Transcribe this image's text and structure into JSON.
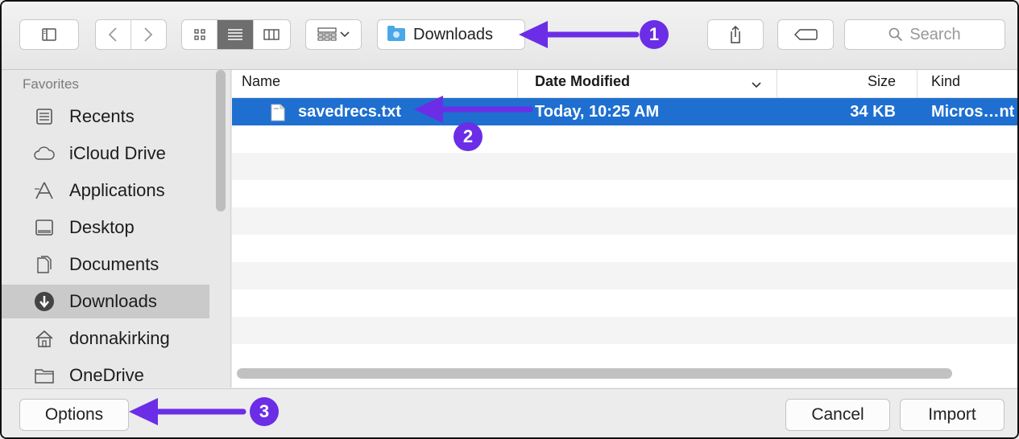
{
  "toolbar": {
    "location": "Downloads",
    "search_placeholder": "Search"
  },
  "sidebar": {
    "heading": "Favorites",
    "items": [
      {
        "label": "Recents",
        "icon": "recents-icon"
      },
      {
        "label": "iCloud Drive",
        "icon": "cloud-icon"
      },
      {
        "label": "Applications",
        "icon": "applications-icon"
      },
      {
        "label": "Desktop",
        "icon": "desktop-icon"
      },
      {
        "label": "Documents",
        "icon": "documents-icon"
      },
      {
        "label": "Downloads",
        "icon": "downloads-icon",
        "selected": true
      },
      {
        "label": "donnakirking",
        "icon": "home-icon"
      },
      {
        "label": "OneDrive",
        "icon": "folder-icon"
      }
    ]
  },
  "columns": {
    "name": "Name",
    "date": "Date Modified",
    "size": "Size",
    "kind": "Kind"
  },
  "files": [
    {
      "name": "savedrecs.txt",
      "date": "Today, 10:25 AM",
      "size": "34 KB",
      "kind": "Micros…nt",
      "selected": true
    }
  ],
  "buttons": {
    "options": "Options",
    "cancel": "Cancel",
    "import": "Import"
  },
  "annotations": {
    "badge1": "1",
    "badge2": "2",
    "badge3": "3"
  },
  "colors": {
    "selection": "#1e6fd0",
    "annotation": "#6b2ee6"
  }
}
